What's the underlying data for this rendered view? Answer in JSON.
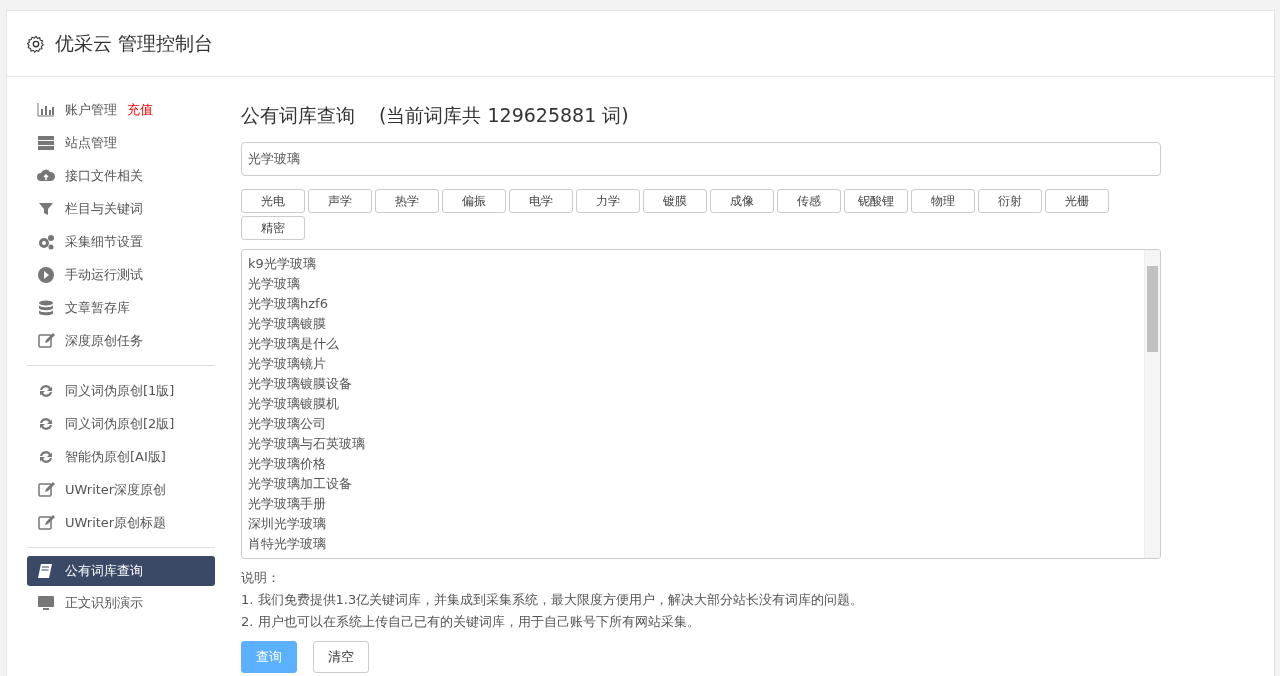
{
  "header": {
    "title": "优采云 管理控制台"
  },
  "sidebar": {
    "groups": [
      {
        "items": [
          {
            "label": "账户管理",
            "badge": "充值",
            "selected": false
          },
          {
            "label": "站点管理",
            "selected": false
          },
          {
            "label": "接口文件相关",
            "selected": false
          },
          {
            "label": "栏目与关键词",
            "selected": false
          },
          {
            "label": "采集细节设置",
            "selected": false
          },
          {
            "label": "手动运行测试",
            "selected": false
          },
          {
            "label": "文章暂存库",
            "selected": false
          },
          {
            "label": "深度原创任务",
            "selected": false
          }
        ]
      },
      {
        "items": [
          {
            "label": "同义词伪原创[1版]",
            "selected": false
          },
          {
            "label": "同义词伪原创[2版]",
            "selected": false
          },
          {
            "label": "智能伪原创[AI版]",
            "selected": false
          },
          {
            "label": "UWriter深度原创",
            "selected": false
          },
          {
            "label": "UWriter原创标题",
            "selected": false
          }
        ]
      },
      {
        "items": [
          {
            "label": "公有词库查询",
            "selected": true
          },
          {
            "label": "正文识别演示",
            "selected": false
          }
        ]
      }
    ]
  },
  "main": {
    "title": "公有词库查询",
    "subtitle": "(当前词库共 129625881 词)",
    "search": {
      "value": "光学玻璃"
    },
    "tags": [
      "光电",
      "声学",
      "热学",
      "偏振",
      "电学",
      "力学",
      "镀膜",
      "成像",
      "传感",
      "铌酸锂",
      "物理",
      "衍射",
      "光栅",
      "精密"
    ],
    "results": [
      "k9光学玻璃",
      "光学玻璃",
      "光学玻璃hzf6",
      "光学玻璃镀膜",
      "光学玻璃是什么",
      "光学玻璃镜片",
      "光学玻璃镀膜设备",
      "光学玻璃镀膜机",
      "光学玻璃公司",
      "光学玻璃与石英玻璃",
      "光学玻璃价格",
      "光学玻璃加工设备",
      "光学玻璃手册",
      "深圳光学玻璃",
      "肖特光学玻璃"
    ],
    "notes_title": "说明：",
    "notes": [
      "1. 我们免费提供1.3亿关键词库，并集成到采集系统，最大限度方便用户，解决大部分站长没有词库的问题。",
      "2. 用户也可以在系统上传自己已有的关键词库，用于自己账号下所有网站采集。"
    ],
    "buttons": [
      {
        "label": "查询",
        "kind": "primary"
      },
      {
        "label": "清空",
        "kind": "secondary"
      }
    ]
  }
}
